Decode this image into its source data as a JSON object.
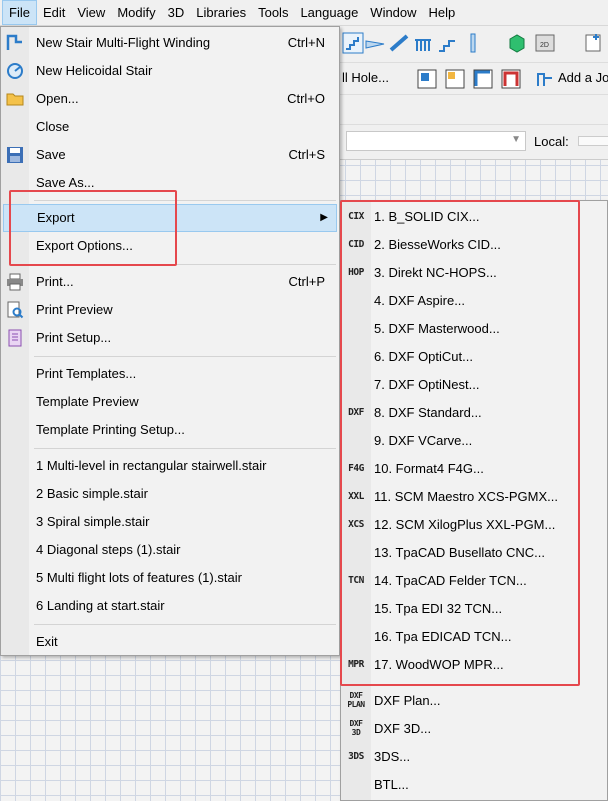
{
  "menubar": {
    "items": [
      {
        "label": "File"
      },
      {
        "label": "Edit"
      },
      {
        "label": "View"
      },
      {
        "label": "Modify"
      },
      {
        "label": "3D"
      },
      {
        "label": "Libraries"
      },
      {
        "label": "Tools"
      },
      {
        "label": "Language"
      },
      {
        "label": "Window"
      },
      {
        "label": "Help"
      }
    ]
  },
  "toolbar": {
    "well_hole_label": "ll Hole...",
    "add_label": "Add a Jo",
    "local_label": "Local:"
  },
  "file_menu": {
    "new_stair_multi": {
      "label": "New Stair Multi-Flight Winding",
      "shortcut": "Ctrl+N"
    },
    "new_helicoidal": {
      "label": "New Helicoidal Stair"
    },
    "open": {
      "label": "Open...",
      "shortcut": "Ctrl+O"
    },
    "close": {
      "label": "Close"
    },
    "save": {
      "label": "Save",
      "shortcut": "Ctrl+S"
    },
    "save_as": {
      "label": "Save As..."
    },
    "export": {
      "label": "Export"
    },
    "export_options": {
      "label": "Export Options..."
    },
    "print": {
      "label": "Print...",
      "shortcut": "Ctrl+P"
    },
    "print_preview": {
      "label": "Print Preview"
    },
    "print_setup": {
      "label": "Print Setup..."
    },
    "print_templates": {
      "label": "Print Templates..."
    },
    "template_preview": {
      "label": "Template Preview"
    },
    "template_printing_setup": {
      "label": "Template Printing Setup..."
    },
    "recent_files": [
      {
        "label": "1 Multi-level in rectangular stairwell.stair"
      },
      {
        "label": "2 Basic simple.stair"
      },
      {
        "label": "3 Spiral simple.stair"
      },
      {
        "label": "4 Diagonal steps (1).stair"
      },
      {
        "label": "5 Multi flight lots of features (1).stair"
      },
      {
        "label": "6 Landing at start.stair"
      }
    ],
    "exit": {
      "label": "Exit"
    }
  },
  "export_submenu": {
    "items": [
      {
        "label": "1. B_SOLID CIX...",
        "tag": "CIX"
      },
      {
        "label": "2. BiesseWorks CID...",
        "tag": "CID"
      },
      {
        "label": "3. Direkt NC-HOPS...",
        "tag": "HOP"
      },
      {
        "label": "4. DXF Aspire...",
        "tag": ""
      },
      {
        "label": "5. DXF Masterwood...",
        "tag": ""
      },
      {
        "label": "6. DXF OptiCut...",
        "tag": ""
      },
      {
        "label": "7. DXF OptiNest...",
        "tag": ""
      },
      {
        "label": "8. DXF Standard...",
        "tag": "DXF"
      },
      {
        "label": "9. DXF VCarve...",
        "tag": ""
      },
      {
        "label": "10. Format4 F4G...",
        "tag": "F4G"
      },
      {
        "label": "11. SCM Maestro XCS-PGMX...",
        "tag": "XXL"
      },
      {
        "label": "12. SCM XilogPlus XXL-PGM...",
        "tag": "XCS"
      },
      {
        "label": "13. TpaCAD Busellato CNC...",
        "tag": ""
      },
      {
        "label": "14. TpaCAD Felder TCN...",
        "tag": "TCN"
      },
      {
        "label": "15. Tpa EDI 32 TCN...",
        "tag": ""
      },
      {
        "label": "16. Tpa EDICAD TCN...",
        "tag": ""
      },
      {
        "label": "17. WoodWOP MPR...",
        "tag": "MPR"
      },
      {
        "label": "DXF Plan...",
        "tag": "DXF",
        "tag_sub": "PLAN"
      },
      {
        "label": "DXF 3D...",
        "tag": "DXF",
        "tag_sub": "3D"
      },
      {
        "label": "3DS...",
        "tag": "3DS"
      },
      {
        "label": "BTL...",
        "tag": ""
      }
    ]
  },
  "colors": {
    "highlight_bg": "#cce4f7",
    "highlight_border": "#99c9ef",
    "annotation_red": "#e5484d"
  }
}
